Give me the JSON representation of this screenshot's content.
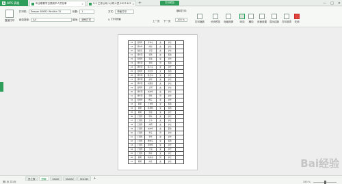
{
  "app": {
    "name": "WPS 表格",
    "logo": "S"
  },
  "tabs": [
    {
      "label": "年出职教学日表新华人员名单",
      "close": "×"
    },
    {
      "label": "2-1 工作公司-1小时人员 2017-6-3",
      "close": "×"
    }
  ],
  "add_tab": "+",
  "mode_title": "打印预览",
  "window_controls": [
    "—",
    "□",
    "×"
  ],
  "toolbar": {
    "print_label": "直接打印",
    "printer_label": "打印机:",
    "printer_value": "Deeper 80652 Wrdlkin 32",
    "paper_label": "纸张类型:",
    "paper_value": "A4",
    "copies_label": "份数:",
    "copies_value": "1",
    "order_label": "顺序:",
    "order_value": "逐份打印",
    "mode_label": "方式:",
    "mode_value": "单面打印",
    "page_label": "横向打印:",
    "prev": "上一页",
    "next": "下一页",
    "zoom_value": "100 %",
    "print_scale": "打印缩放",
    "margin": "显示边距",
    "page_setup": "页面设置",
    "portrait": "纵向",
    "landscape": "横向",
    "header_footer": "页眉页脚",
    "page_break": "分页预览",
    "options": "打印选项",
    "close": "关闭",
    "ink_save": "显示边距",
    "print_header": "打印页眉"
  },
  "table_rows": [
    [
      "18",
      "张明华",
      "李中心",
      "女",
      "护士"
    ],
    [
      "19",
      "郭中华",
      "刘新",
      "女",
      "护士"
    ],
    [
      "20",
      "张希东",
      "王阳",
      "女",
      "护士"
    ],
    [
      "21",
      "郭华同",
      "郭洪",
      "女",
      "医生"
    ],
    [
      "22",
      "张明华",
      "张强",
      "女",
      "护士"
    ],
    [
      "23",
      "郭华同",
      "李明",
      "男",
      "医生"
    ],
    [
      "24",
      "郭华同",
      "陈少东",
      "女",
      "护士"
    ],
    [
      "25",
      "张明华",
      "刘立伟",
      "女",
      "医生"
    ],
    [
      "26",
      "郭华同",
      "陈志平",
      "女",
      "护士"
    ],
    [
      "27",
      "郭华同",
      "赵华",
      "女",
      "护士"
    ],
    [
      "28",
      "郭华同",
      "刘国东",
      "女",
      "护士"
    ],
    [
      "29",
      "张明华",
      "王明",
      "女",
      "护士"
    ],
    [
      "30",
      "郭华同",
      "刘中华",
      "女",
      "护士"
    ],
    [
      "31",
      "郭华同",
      "郭华",
      "男",
      "护士"
    ],
    [
      "32",
      "张明华",
      "杨东",
      "女",
      "护士"
    ],
    [
      "33",
      "韩明",
      "王中华",
      "女",
      "医生"
    ],
    [
      "34",
      "韩明",
      "陈明华",
      "女",
      "医生"
    ],
    [
      "35",
      "韩明",
      "张强",
      "女",
      "护士"
    ],
    [
      "36",
      "王国伟",
      "郭东",
      "女",
      "护士"
    ],
    [
      "37",
      "王国伟",
      "王中",
      "女",
      "护士"
    ],
    [
      "38",
      "王国伟",
      "刘明",
      "女",
      "护士"
    ],
    [
      "39",
      "王国伟",
      "刘中华",
      "女",
      "医生"
    ],
    [
      "40",
      "王国伟",
      "李东",
      "男",
      "护士"
    ],
    [
      "41",
      "王国伟",
      "李华",
      "女",
      "护士"
    ],
    [
      "42",
      "王国伟",
      "杨中东",
      "女",
      "医生"
    ],
    [
      "43",
      "王国伟",
      "郭中华",
      "女",
      "护士"
    ],
    [
      "44",
      "王国伟",
      "王强",
      "女",
      "护士"
    ],
    [
      "45",
      "王国伟",
      "陈华",
      "女",
      "护士"
    ],
    [
      "46",
      "韩明",
      "刘中东",
      "男",
      "护士"
    ],
    [
      "47",
      "韩明",
      "刘东",
      "女",
      "护士"
    ]
  ],
  "sheets": [
    "员工表",
    "打印",
    "Sheet",
    "Sheet2",
    "Sheet3"
  ],
  "active_sheet": 1,
  "sheet_add": "+",
  "status": {
    "left": "第1页 共1页",
    "zoom": "100 %"
  },
  "watermark": "Bai经验"
}
